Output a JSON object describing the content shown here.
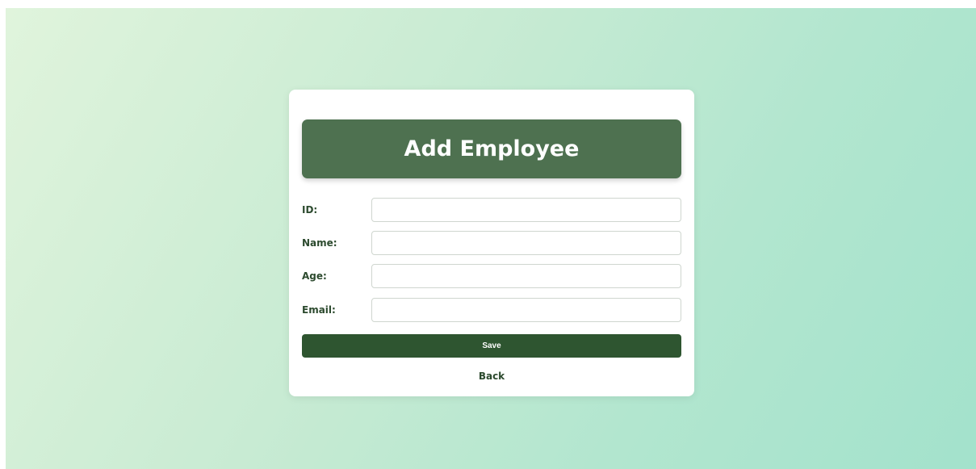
{
  "page": {
    "title": "Add Employee"
  },
  "form": {
    "fields": [
      {
        "label": "ID:",
        "value": "",
        "placeholder": ""
      },
      {
        "label": "Name:",
        "value": "",
        "placeholder": ""
      },
      {
        "label": "Age:",
        "value": "",
        "placeholder": ""
      },
      {
        "label": "Email:",
        "value": "",
        "placeholder": ""
      }
    ],
    "save_label": "Save",
    "back_label": "Back"
  },
  "colors": {
    "header_bg": "#4e7150",
    "button_bg": "#2e5530",
    "label_text": "#2c4a2e"
  }
}
